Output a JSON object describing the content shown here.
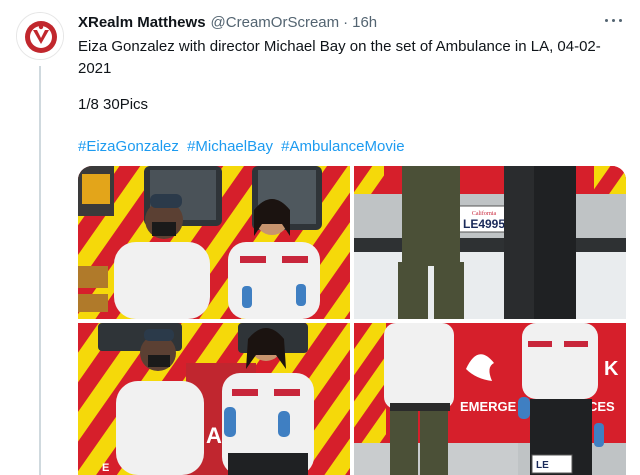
{
  "tweet": {
    "author_name": "XRealm Matthews",
    "handle": "@CreamOrScream",
    "separator": "·",
    "time": "16h",
    "text_line": "Eiza Gonzalez with director Michael Bay on the set of Ambulance in LA, 04-02-2021",
    "count_line": "1/8 30Pics",
    "hashtags": [
      "#EizaGonzalez",
      "#MichaelBay",
      "#AmbulanceMovie"
    ]
  },
  "media": {
    "photos": [
      {
        "alt": "ambulance-stripes-photo-1"
      },
      {
        "alt": "ambulance-rear-photo-2"
      },
      {
        "alt": "ambulance-stripes-photo-3"
      },
      {
        "alt": "emergency-services-photo-4"
      }
    ],
    "scene_text": {
      "plate": "LE4995",
      "plate_state": "California",
      "side_text_1": "EMERGE",
      "side_text_2": "CES",
      "side_text_3": "K",
      "side_text_4": "A",
      "side_text_5": "E",
      "side_text_6": "LE"
    }
  },
  "colors": {
    "accent": "#1d9bf0",
    "ambulance_red": "#d61f2b",
    "ambulance_yellow": "#f5d90a",
    "uniform_white": "#f1f1f1"
  },
  "icons": [
    "avatar-logo-icon",
    "more-icon"
  ]
}
